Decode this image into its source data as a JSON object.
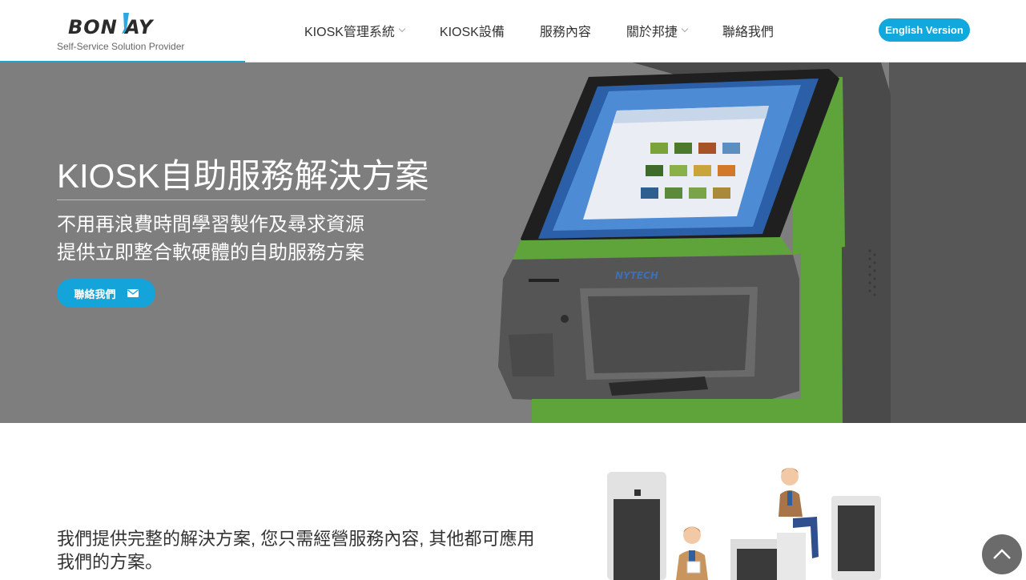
{
  "header": {
    "logo": {
      "wordmark": "BON AY",
      "tagline": "Self-Service Solution Provider"
    },
    "nav": [
      {
        "label": "KIOSK管理系統",
        "has_dropdown": true
      },
      {
        "label": "KIOSK設備",
        "has_dropdown": false
      },
      {
        "label": "服務內容",
        "has_dropdown": false
      },
      {
        "label": "關於邦捷",
        "has_dropdown": true
      },
      {
        "label": "聯絡我們",
        "has_dropdown": false
      }
    ],
    "language_button": "English Version"
  },
  "hero": {
    "title": "KIOSK自助服務解決方案",
    "line1": "不用再浪費時間學習製作及尋求資源",
    "line2": "提供立即整合軟硬體的自助服務方案",
    "contact_button": "聯絡我們",
    "kiosk_brand": "NYTECH"
  },
  "intro": {
    "text": "我們提供完整的解決方案, 您只需經營服務內容, 其他都可應用我們的方案。"
  },
  "colors": {
    "accent": "#11a8de",
    "hero_bg": "#7e7e7e",
    "kiosk_green": "#5fa43a"
  },
  "icons": {
    "mail": "envelope-icon",
    "scroll_top": "chevron-up-icon",
    "dropdown": "chevron-down-icon"
  }
}
